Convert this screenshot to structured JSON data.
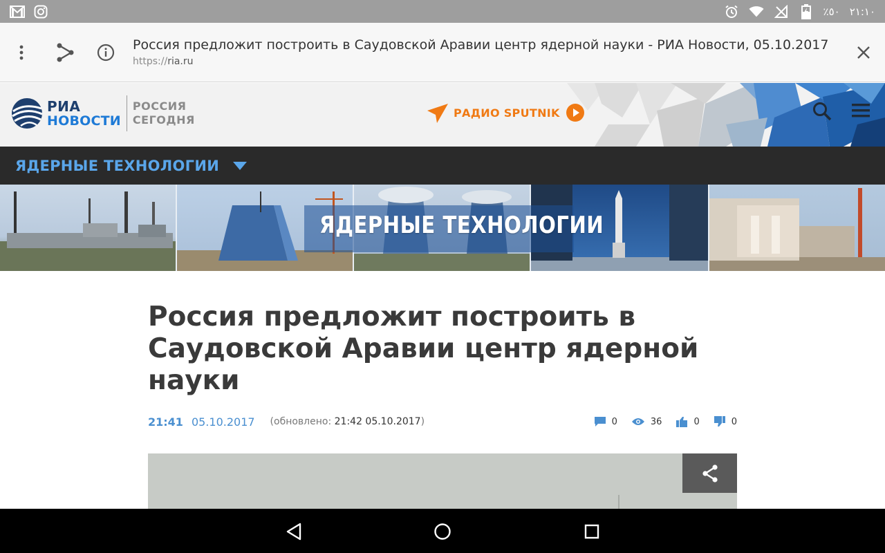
{
  "status_bar": {
    "left_icons": [
      "gmail-icon",
      "instagram-icon"
    ],
    "right_icons": [
      "alarm-icon",
      "wifi-icon",
      "no-sim-icon",
      "battery-charging-icon"
    ],
    "battery": "٪٥٠",
    "time": "٢١:١٠"
  },
  "toolbar": {
    "title": "Россия предложит построить в Саудовской Аравии центр ядерной науки - РИА Новости, 05.10.2017",
    "url_scheme": "https://",
    "url_host": "ria.ru",
    "icons": [
      "more-vert-icon",
      "share-icon",
      "info-icon",
      "close-icon"
    ]
  },
  "header": {
    "logo_line1": "РИА",
    "logo_line2": "НОВОСТИ",
    "partner_line1": "РОССИЯ",
    "partner_line2": "СЕГОДНЯ",
    "radio_label": "РАДИО SPUTNIK",
    "icons": [
      "search-icon",
      "menu-icon"
    ],
    "colors": {
      "ria_dark": "#1e3f6e",
      "ria_blue": "#1e7ad6",
      "sputnik_orange": "#f07a14"
    }
  },
  "section_nav": {
    "label": "ЯДЕРНЫЕ ТЕХНОЛОГИИ",
    "color": "#5aa6ea"
  },
  "banner": {
    "title": "ЯДЕРНЫЕ ТЕХНОЛОГИИ"
  },
  "article": {
    "title": "Россия предложит построить в Саудовской Аравии центр ядерной науки",
    "time": "21:41",
    "date": "05.10.2017",
    "updated_prefix": "(обновлено: ",
    "updated_value": "21:42 05.10.2017",
    "updated_suffix": ")",
    "stats": {
      "comments": "0",
      "views": "36",
      "likes": "0",
      "dislikes": "0"
    }
  },
  "nav_bar": {
    "icons": [
      "back-icon",
      "home-icon",
      "recents-icon"
    ]
  }
}
